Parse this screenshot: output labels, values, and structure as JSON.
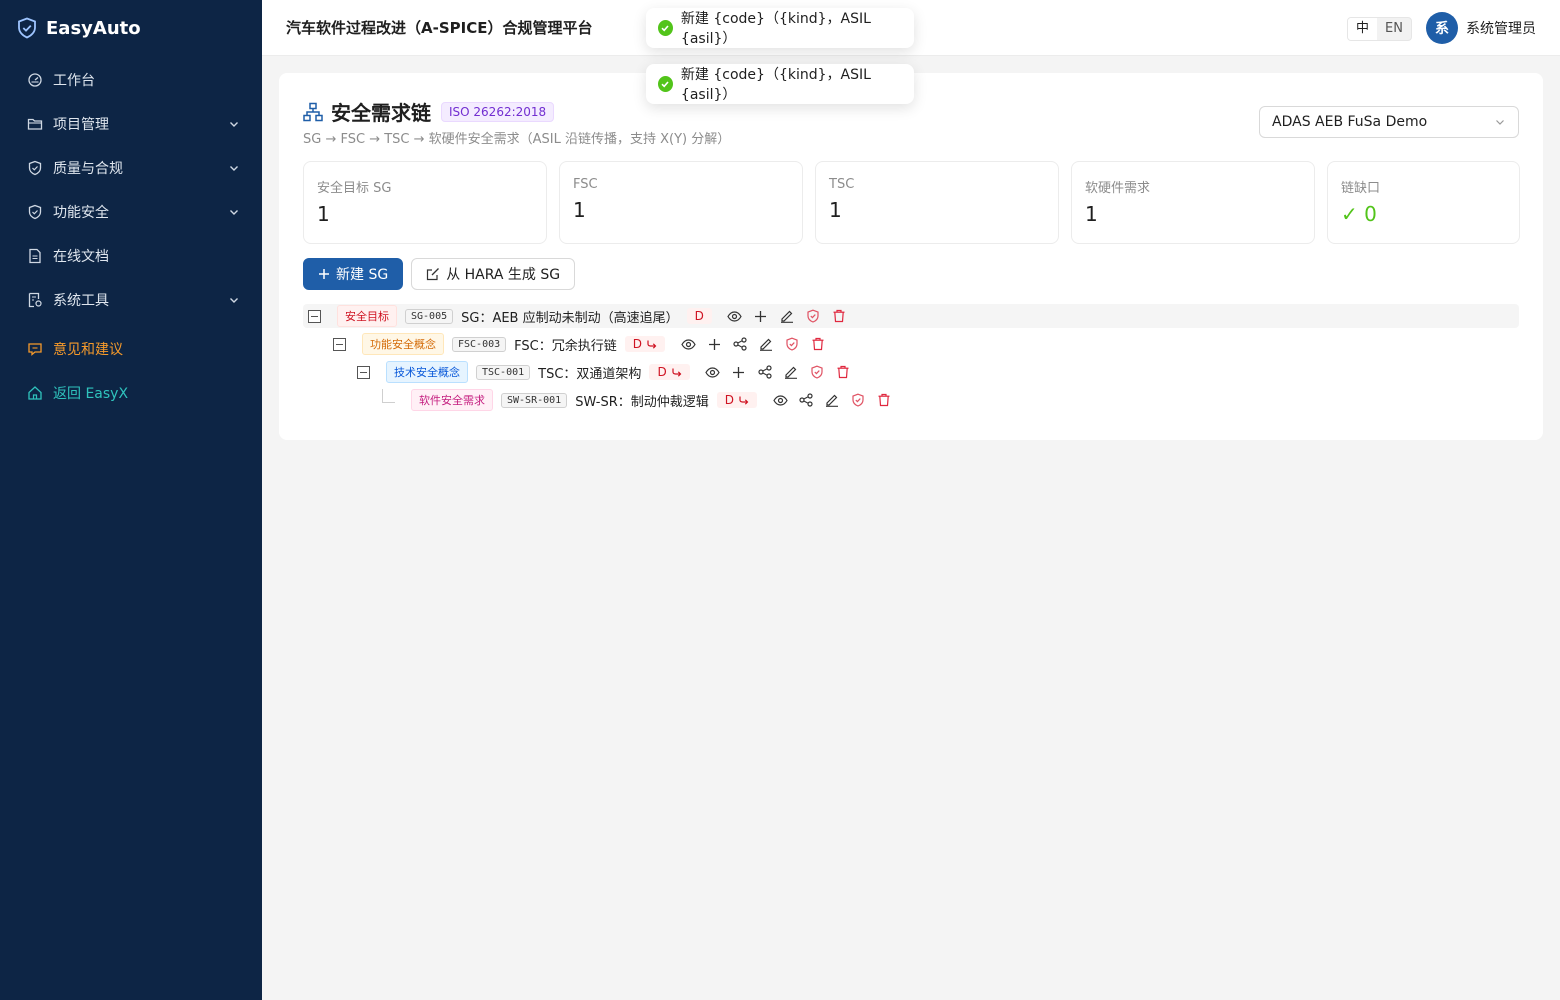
{
  "brand": {
    "name": "EasyAuto"
  },
  "sidebar": {
    "items": [
      {
        "label": "工作台",
        "icon": "dashboard-icon",
        "expandable": false
      },
      {
        "label": "项目管理",
        "icon": "folder-icon",
        "expandable": true
      },
      {
        "label": "质量与合规",
        "icon": "shield-check-icon",
        "expandable": true
      },
      {
        "label": "功能安全",
        "icon": "shield-check-icon",
        "expandable": true
      },
      {
        "label": "在线文档",
        "icon": "document-icon",
        "expandable": false
      },
      {
        "label": "系统工具",
        "icon": "tools-icon",
        "expandable": true
      }
    ],
    "feedback": "意见和建议",
    "back": "返回 EasyX"
  },
  "header": {
    "title": "汽车软件过程改进（A-SPICE）合规管理平台",
    "lang_zh": "中",
    "lang_en": "EN",
    "avatar_text": "系",
    "user_name": "系统管理员"
  },
  "toasts": [
    {
      "text": "新建 {code}（{kind}，ASIL {asil}）"
    },
    {
      "text": "新建 {code}（{kind}，ASIL {asil}）"
    }
  ],
  "page": {
    "title": "安全需求链",
    "standard_tag": "ISO 26262:2018",
    "subtitle": "SG → FSC → TSC → 软硬件安全需求（ASIL 沿链传播，支持 X(Y) 分解）",
    "project_select": "ADAS AEB FuSa Demo"
  },
  "stats": [
    {
      "label": "安全目标 SG",
      "value": "1"
    },
    {
      "label": "FSC",
      "value": "1"
    },
    {
      "label": "TSC",
      "value": "1"
    },
    {
      "label": "软硬件需求",
      "value": "1"
    },
    {
      "label": "链缺口",
      "value": "✓ 0"
    }
  ],
  "buttons": {
    "new_sg": "新建 SG",
    "from_hara": "从 HARA 生成 SG"
  },
  "tree": [
    {
      "level": 0,
      "kind": "安全目标",
      "kind_class": "sg",
      "code": "SG-005",
      "title": "SG：AEB 应制动未制动（高速追尾）",
      "asil": "D",
      "inherited": false
    },
    {
      "level": 1,
      "kind": "功能安全概念",
      "kind_class": "fsc",
      "code": "FSC-003",
      "title": "FSC：冗余执行链",
      "asil": "D",
      "inherited": true
    },
    {
      "level": 2,
      "kind": "技术安全概念",
      "kind_class": "tsc",
      "code": "TSC-001",
      "title": "TSC：双通道架构",
      "asil": "D",
      "inherited": true
    },
    {
      "level": 3,
      "kind": "软件安全需求",
      "kind_class": "sw",
      "code": "SW-SR-001",
      "title": "SW-SR：制动仲裁逻辑",
      "asil": "D",
      "inherited": true
    }
  ],
  "colors": {
    "sidebar_bg": "#0d2545",
    "primary": "#1f5ea8",
    "success": "#52c41a",
    "danger": "#cf1322",
    "feedback": "#f59a2b",
    "back_link": "#2fc3bd"
  }
}
